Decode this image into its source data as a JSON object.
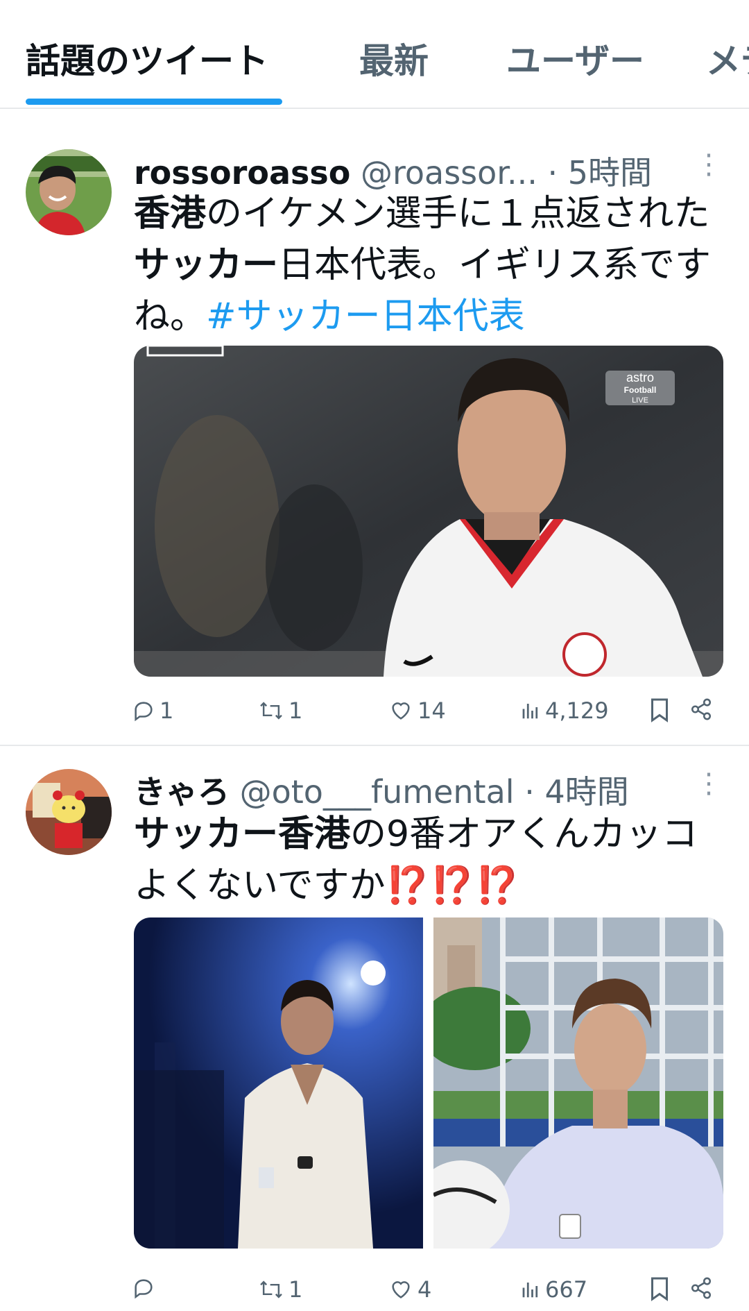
{
  "tabs": [
    {
      "label": "話題のツイート",
      "active": true
    },
    {
      "label": "最新",
      "active": false
    },
    {
      "label": "ユーザー",
      "active": false
    },
    {
      "label": "メディア",
      "active": false
    }
  ],
  "tweets": [
    {
      "name": "rossoroasso",
      "handle": "@roassor...",
      "time": "· 5時間",
      "text_bold": "香港",
      "text_a": "のイケメン選手に１点返された",
      "text_bold2": "サッカー",
      "text_b": "日本代表。イギリス系ですね。",
      "hashtag": "#サッカー日本代表",
      "media_badge": {
        "line1": "astro",
        "line2": "Football",
        "line3": "LIVE"
      },
      "stats": {
        "replies": "1",
        "retweets": "1",
        "likes": "14",
        "views": "4,129"
      }
    },
    {
      "name": "きゃろ",
      "handle": "@oto___fumental",
      "time": "· 4時間",
      "text_bold": "サッカー香港",
      "text_a": "の9番オアくんカッコよくないですか",
      "alarm": "⁉️⁉️⁉️",
      "stats": {
        "replies": "",
        "retweets": "1",
        "likes": "4",
        "views": "667"
      }
    }
  ],
  "colors": {
    "accent": "#1d9bf0",
    "muted": "#536471",
    "divider": "#e7e9eb"
  }
}
